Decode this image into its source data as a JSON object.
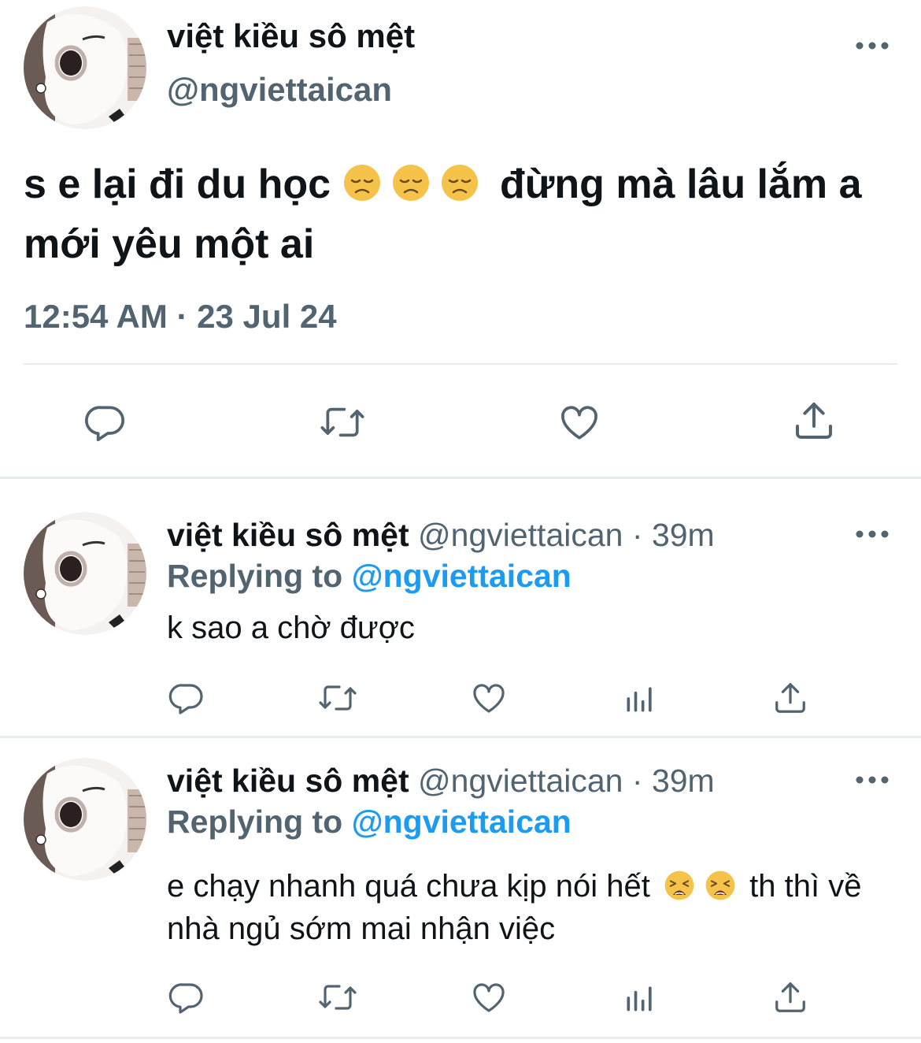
{
  "main_tweet": {
    "display_name": "việt kiều sô mệt",
    "handle": "@ngviettaican",
    "text_part1": "s e lại đi du học",
    "emoji_name": "disappointed-face-emoji",
    "text_part2": "đừng mà lâu lắm a mới yêu một ai",
    "timestamp": "12:54 AM · 23 Jul 24",
    "actions": [
      "reply-icon",
      "retweet-icon",
      "like-icon",
      "share-icon"
    ]
  },
  "replies": [
    {
      "display_name": "việt kiều sô mệt",
      "handle": "@ngviettaican",
      "separator": "·",
      "time": "39m",
      "replying_label": "Replying to",
      "replying_handle": "@ngviettaican",
      "text_part1": "k sao a chờ được",
      "text_part2": "",
      "actions": [
        "reply-icon",
        "retweet-icon",
        "like-icon",
        "views-icon",
        "share-icon"
      ]
    },
    {
      "display_name": "việt kiều sô mệt",
      "handle": "@ngviettaican",
      "separator": "·",
      "time": "39m",
      "replying_label": "Replying to",
      "replying_handle": "@ngviettaican",
      "text_part1": "e chạy nhanh quá chưa kịp nói hết",
      "emoji_name": "weary-face-emoji",
      "text_part2": "th thì về nhà ngủ sớm mai nhận việc",
      "actions": [
        "reply-icon",
        "retweet-icon",
        "like-icon",
        "views-icon",
        "share-icon"
      ]
    }
  ],
  "colors": {
    "text": "#0f1419",
    "secondary": "#536471",
    "link": "#1d9bf0",
    "divider": "#e6ecf0"
  }
}
